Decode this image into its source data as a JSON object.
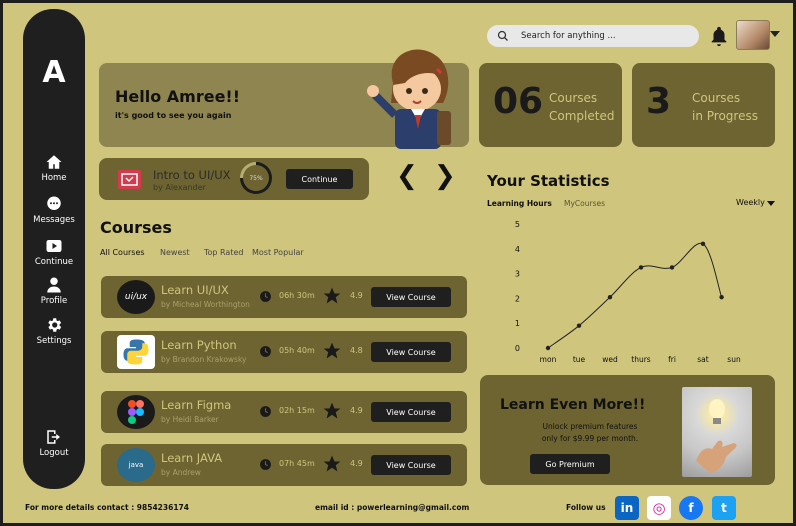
{
  "sidebar": {
    "logo": "A",
    "items": [
      {
        "label": "Home",
        "icon": "home-icon"
      },
      {
        "label": "Messages",
        "icon": "messages-icon"
      },
      {
        "label": "Continue",
        "icon": "play-icon"
      },
      {
        "label": "Profile",
        "icon": "user-icon"
      },
      {
        "label": "Settings",
        "icon": "gear-icon"
      }
    ],
    "logout": "Logout"
  },
  "header": {
    "search_placeholder": "Search for anything ..."
  },
  "greeting": {
    "title": "Hello Amree!!",
    "subtitle": "it's good to see you again"
  },
  "stats_cards": [
    {
      "number": "06",
      "label_line1": "Courses",
      "label_line2": "Completed"
    },
    {
      "number": "3",
      "label_line1": "Courses",
      "label_line2": "in Progress"
    }
  ],
  "current_course": {
    "title": "Intro to UI/UX",
    "author": "by Alexander",
    "progress": 75,
    "progress_label": "75%",
    "button": "Continue"
  },
  "nav_arrows": {
    "prev": "❮",
    "next": "❯"
  },
  "courses": {
    "title": "Courses",
    "filters": [
      "All Courses",
      "Newest",
      "Top Rated",
      "Most Popular"
    ],
    "active_filter": "All Courses",
    "button_label": "View Course",
    "items": [
      {
        "title": "Learn UI/UX",
        "author": "by Micheal Worthington",
        "duration": "06h 30m",
        "rating": "4.9",
        "logo": "ui/ux"
      },
      {
        "title": "Learn Python",
        "author": "by Brandon Krakowsky",
        "duration": "05h 40m",
        "rating": "4.8",
        "logo": "python"
      },
      {
        "title": "Learn Figma",
        "author": "by Heidi Barker",
        "duration": "02h 15m",
        "rating": "4.9",
        "logo": "figma"
      },
      {
        "title": "Learn JAVA",
        "author": "by Andrew",
        "duration": "07h 45m",
        "rating": "4.9",
        "logo": "java"
      }
    ]
  },
  "statistics": {
    "title": "Your Statistics",
    "tabs": [
      "Learning Hours",
      "MyCourses"
    ],
    "active_tab": "Learning Hours",
    "period": "Weekly"
  },
  "chart_data": {
    "type": "line",
    "title": "",
    "xlabel": "",
    "ylabel": "",
    "categories": [
      "mon",
      "tue",
      "wed",
      "thurs",
      "fri",
      "sat",
      "sun"
    ],
    "x_points": [
      0,
      1,
      2,
      3,
      4,
      5,
      5.6
    ],
    "values": [
      0,
      0.9,
      2.05,
      3.25,
      3.25,
      4.2,
      2.05
    ],
    "yticks": [
      0,
      1,
      2,
      3,
      4,
      5
    ],
    "ylim": [
      0,
      5
    ],
    "grid": false
  },
  "promo": {
    "title": "Learn Even More!!",
    "line1": "Unlock premium features",
    "line2": "only for $9.99 per month.",
    "button": "Go Premium"
  },
  "footer": {
    "contact": "For more details contact : 9854236174",
    "email": "email id : powerlearning@gmail.com",
    "follow": "Follow us",
    "socials": [
      "in",
      "◎",
      "f",
      "t"
    ]
  },
  "colors": {
    "background": "#cfc57c",
    "card_dark": "#6e6431",
    "sidebar": "#1f1f1f",
    "linkedin": "#0a66c2",
    "facebook": "#1877f2",
    "twitter": "#1da1f2"
  }
}
